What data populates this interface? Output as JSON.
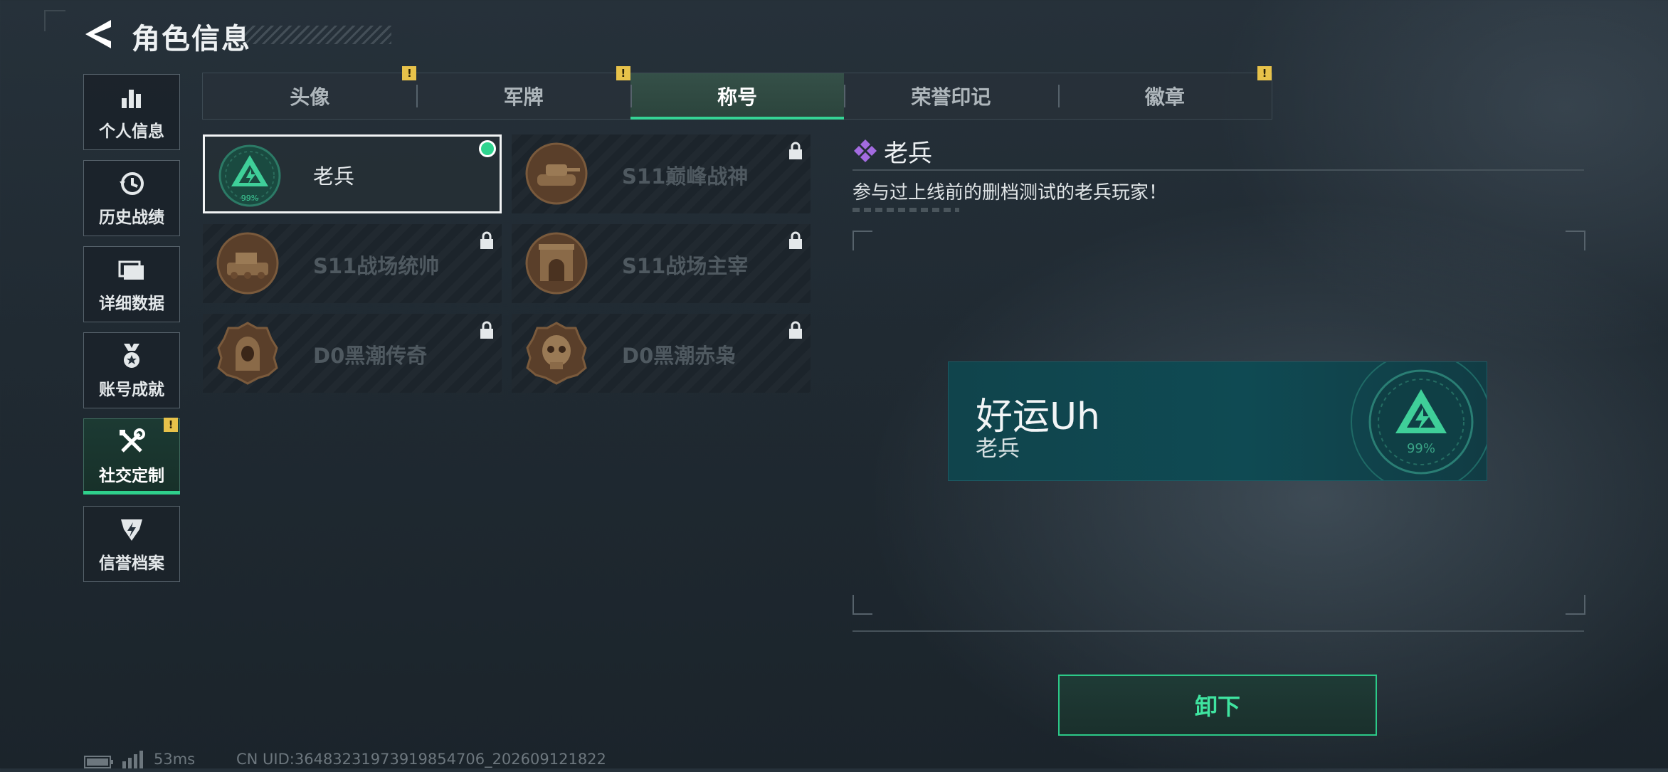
{
  "header": {
    "title": "角色信息"
  },
  "sidebar": {
    "items": [
      {
        "label": "个人信息",
        "icon": "bar-chart-icon"
      },
      {
        "label": "历史战绩",
        "icon": "history-clock-icon"
      },
      {
        "label": "详细数据",
        "icon": "folder-icon"
      },
      {
        "label": "账号成就",
        "icon": "medal-icon"
      },
      {
        "label": "社交定制",
        "icon": "wrench-screwdriver-icon",
        "active": true,
        "alert": "!"
      },
      {
        "label": "信誉档案",
        "icon": "shield-emblem-icon"
      }
    ]
  },
  "tabs": [
    {
      "label": "头像",
      "alert": "!"
    },
    {
      "label": "军牌",
      "alert": "!"
    },
    {
      "label": "称号",
      "active": true
    },
    {
      "label": "荣誉印记"
    },
    {
      "label": "徽章",
      "alert": "!"
    }
  ],
  "titles": [
    {
      "name": "老兵",
      "selected": true,
      "equipped": true,
      "emblem": "veteran-triangle-icon",
      "emblem_text": "99%"
    },
    {
      "name": "S11巅峰战神",
      "locked": true,
      "emblem": "tank-bronze-icon"
    },
    {
      "name": "S11战场统帅",
      "locked": true,
      "emblem": "armored-vehicle-bronze-icon"
    },
    {
      "name": "S11战场主宰",
      "locked": true,
      "emblem": "arch-bronze-icon"
    },
    {
      "name": "D0黑潮传奇",
      "locked": true,
      "emblem": "hooded-figure-bronze-icon"
    },
    {
      "name": "D0黑潮赤枭",
      "locked": true,
      "emblem": "skull-bronze-icon"
    }
  ],
  "detail": {
    "title": "老兵",
    "description": "参与过上线前的删档测试的老兵玩家！",
    "preview": {
      "player_name": "好运Uh",
      "title": "老兵",
      "emblem_text": "99%"
    },
    "action_label": "卸下"
  },
  "status": {
    "ping": "53ms",
    "uid": "CN UID:36483231973919854706_202609121822"
  },
  "colors": {
    "accent": "#2fd08c",
    "alert": "#e7c24a",
    "rarity": "#9b5fd6"
  }
}
